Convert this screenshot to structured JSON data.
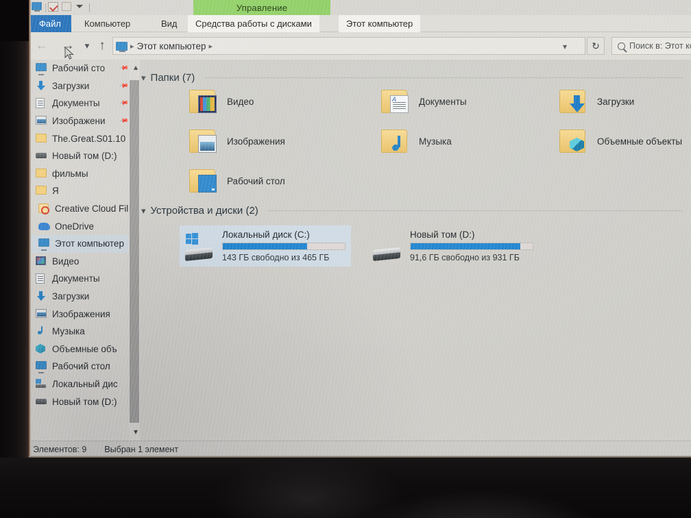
{
  "window": {
    "quick_access": [
      "this-pc-icon",
      "properties-icon",
      "new-folder-icon",
      "customize-caret-icon"
    ]
  },
  "ribbon": {
    "contextual_group_label": "Управление",
    "tabs": [
      {
        "label": "Файл",
        "name": "tab-file"
      },
      {
        "label": "Компьютер",
        "name": "tab-computer"
      },
      {
        "label": "Вид",
        "name": "tab-view"
      },
      {
        "label": "Средства работы с дисками",
        "name": "tab-drive-tools"
      },
      {
        "label": "Этот компьютер",
        "name": "tab-this-pc"
      }
    ]
  },
  "navigation": {
    "back_icon": "back-arrow-icon",
    "forward_icon": "forward-arrow-icon",
    "history_icon": "chevron-down-icon",
    "up_icon": "up-arrow-icon",
    "breadcrumb": "Этот компьютер",
    "refresh_icon": "refresh-icon",
    "search_placeholder": "Поиск в: Этот компью"
  },
  "sidebar": {
    "items": [
      {
        "label": "Рабочий сто",
        "icon": "desktop-icon",
        "pinned": true,
        "indent": true,
        "selected": false
      },
      {
        "label": "Загрузки",
        "icon": "download-icon",
        "pinned": true,
        "indent": true,
        "selected": false
      },
      {
        "label": "Документы",
        "icon": "documents-icon",
        "pinned": true,
        "indent": true,
        "selected": false
      },
      {
        "label": "Изображени",
        "icon": "pictures-icon",
        "pinned": true,
        "indent": true,
        "selected": false
      },
      {
        "label": "The.Great.S01.10",
        "icon": "folder-icon",
        "pinned": false,
        "indent": true,
        "selected": false
      },
      {
        "label": "Новый том (D:)",
        "icon": "drive-icon",
        "pinned": false,
        "indent": true,
        "selected": false
      },
      {
        "label": "фильмы",
        "icon": "folder-icon",
        "pinned": false,
        "indent": true,
        "selected": false
      },
      {
        "label": "Я",
        "icon": "folder-icon",
        "pinned": false,
        "indent": true,
        "selected": false
      },
      {
        "label": "Creative Cloud Fil",
        "icon": "creative-cloud-icon",
        "pinned": false,
        "indent": false,
        "selected": false
      },
      {
        "label": "OneDrive",
        "icon": "onedrive-icon",
        "pinned": false,
        "indent": false,
        "selected": false
      },
      {
        "label": "Этот компьютер",
        "icon": "this-pc-icon",
        "pinned": false,
        "indent": false,
        "selected": true
      },
      {
        "label": "Видео",
        "icon": "video-icon",
        "pinned": false,
        "indent": true,
        "selected": false
      },
      {
        "label": "Документы",
        "icon": "documents-icon",
        "pinned": false,
        "indent": true,
        "selected": false
      },
      {
        "label": "Загрузки",
        "icon": "download-icon",
        "pinned": false,
        "indent": true,
        "selected": false
      },
      {
        "label": "Изображения",
        "icon": "pictures-icon",
        "pinned": false,
        "indent": true,
        "selected": false
      },
      {
        "label": "Музыка",
        "icon": "music-icon",
        "pinned": false,
        "indent": true,
        "selected": false
      },
      {
        "label": "Объемные объ",
        "icon": "3d-objects-icon",
        "pinned": false,
        "indent": true,
        "selected": false
      },
      {
        "label": "Рабочий стол",
        "icon": "desktop-icon",
        "pinned": false,
        "indent": true,
        "selected": false
      },
      {
        "label": "Локальный дис",
        "icon": "local-disk-icon",
        "pinned": false,
        "indent": true,
        "selected": false
      },
      {
        "label": "Новый том (D:)",
        "icon": "drive-icon",
        "pinned": false,
        "indent": true,
        "selected": false
      }
    ],
    "scroll_up_icon": "chevron-up-icon",
    "scroll_down_icon": "chevron-down-icon"
  },
  "content": {
    "folders_group": {
      "title": "Папки (7)",
      "items": [
        {
          "label": "Видео",
          "overlay": "video-overlay-icon",
          "col": 0,
          "row": 0
        },
        {
          "label": "Документы",
          "overlay": "document-overlay-icon",
          "col": 1,
          "row": 0
        },
        {
          "label": "Загрузки",
          "overlay": "download-overlay-icon",
          "col": 2,
          "row": 0
        },
        {
          "label": "Изображения",
          "overlay": "picture-overlay-icon",
          "col": 0,
          "row": 1
        },
        {
          "label": "Музыка",
          "overlay": "music-overlay-icon",
          "col": 1,
          "row": 1
        },
        {
          "label": "Объемные объекты",
          "overlay": "3d-overlay-icon",
          "col": 2,
          "row": 1
        },
        {
          "label": "Рабочий стол",
          "overlay": "desktop-overlay-icon",
          "col": 0,
          "row": 2
        }
      ]
    },
    "drives_group": {
      "title": "Устройства и диски (2)",
      "items": [
        {
          "name": "Локальный диск (C:)",
          "free_text": "143 ГБ свободно из 465 ГБ",
          "used_percent": 69,
          "selected": true,
          "icon": "windows-drive-icon"
        },
        {
          "name": "Новый том (D:)",
          "free_text": "91,6 ГБ свободно из 931 ГБ",
          "used_percent": 90,
          "selected": false,
          "icon": "drive-icon"
        }
      ]
    }
  },
  "statusbar": {
    "item_count": "Элементов: 9",
    "selection": "Выбран 1 элемент"
  },
  "colors": {
    "accent_blue": "#1b82ce",
    "file_tab_blue": "#1868b5",
    "contextual_green": "#8fcf64",
    "selection_blue": "#cedae4",
    "window_bg": "#cecdc8"
  }
}
